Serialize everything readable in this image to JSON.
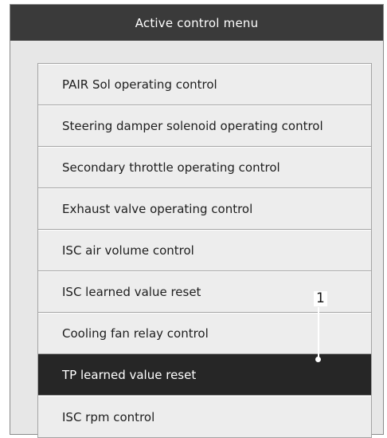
{
  "window": {
    "title": "Active control menu"
  },
  "menu": {
    "items": [
      {
        "label": "PAIR Sol operating control"
      },
      {
        "label": "Steering damper solenoid operating control"
      },
      {
        "label": "Secondary throttle operating control"
      },
      {
        "label": "Exhaust valve operating control"
      },
      {
        "label": "ISC air volume control"
      },
      {
        "label": "ISC learned value reset"
      },
      {
        "label": "Cooling fan relay control"
      },
      {
        "label": "TP learned value reset",
        "selected": true
      },
      {
        "label": "ISC rpm control"
      }
    ]
  },
  "callout": {
    "label": "1"
  },
  "colors": {
    "title_bar": "#3a3a3a",
    "window_bg": "#e7e7e7",
    "item_bg": "#ededed",
    "selected_bg": "#262626",
    "selected_text": "#ffffff"
  }
}
